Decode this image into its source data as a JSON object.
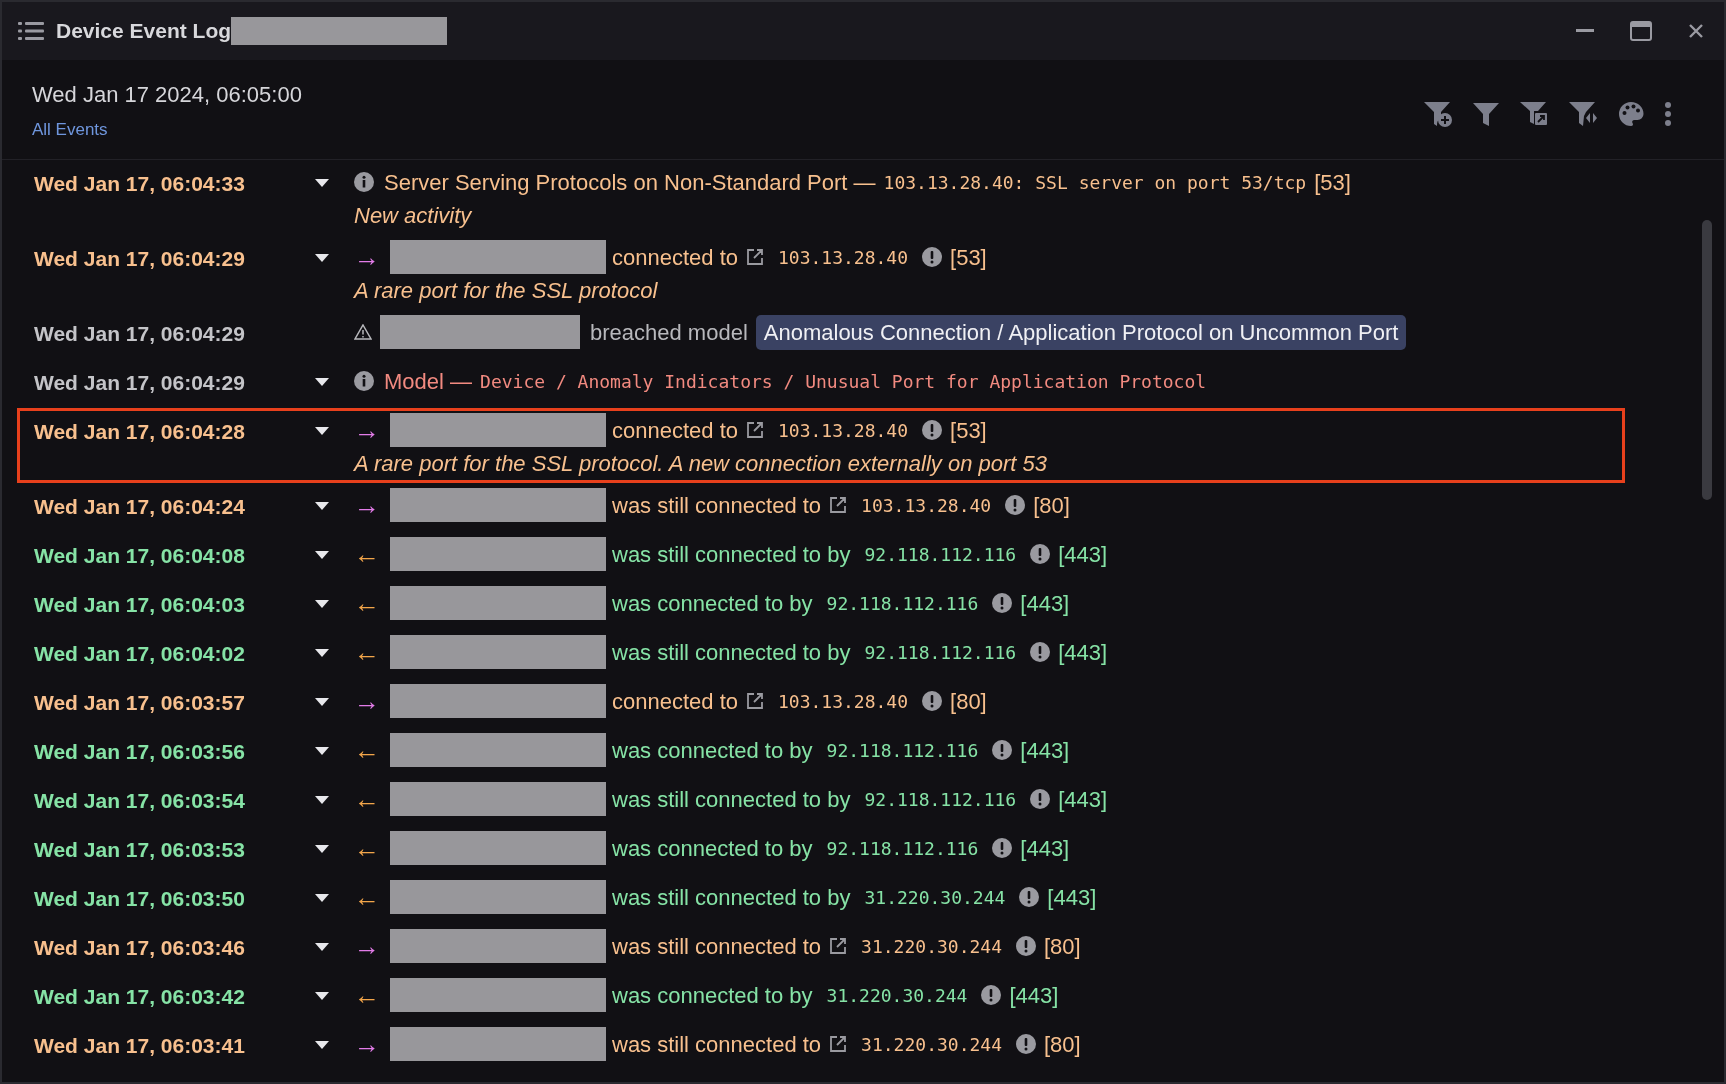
{
  "window": {
    "title": "Device Event Log"
  },
  "header": {
    "datetime": "Wed Jan 17 2024, 06:05:00",
    "filter_link": "All Events"
  },
  "events": [
    {
      "kind": "notice",
      "time": "Wed Jan 17, 06:04:33",
      "color": "#f8c08e",
      "expandable": true,
      "selected": false,
      "title": "Server Serving Protocols on Non-Standard Port —",
      "detail": "103.13.28.40: SSL server on port 53/tcp",
      "port": "[53]",
      "note": "New activity"
    },
    {
      "kind": "connection",
      "time": "Wed Jan 17, 06:04:29",
      "color": "#f8c08e",
      "expandable": true,
      "selected": false,
      "arrow": "→",
      "outgoing": true,
      "verb": "connected to",
      "external": true,
      "ip": "103.13.28.40",
      "port": "[53]",
      "note": "A rare port for the SSL protocol"
    },
    {
      "kind": "breach",
      "time": "Wed Jan 17, 06:04:29",
      "color": "#c4c4c8",
      "expandable": false,
      "selected": false,
      "verb": "breached model",
      "tag": "Anomalous Connection / Application Protocol on Uncommon Port"
    },
    {
      "kind": "model",
      "time": "Wed Jan 17, 06:04:29",
      "color": "#c4c4c8",
      "expandable": true,
      "selected": false,
      "label": "Model —",
      "path": "Device / Anomaly Indicators / Unusual Port for Application Protocol"
    },
    {
      "kind": "connection",
      "time": "Wed Jan 17, 06:04:28",
      "color": "#f8c08e",
      "expandable": true,
      "selected": true,
      "arrow": "→",
      "outgoing": true,
      "verb": "connected to",
      "external": true,
      "ip": "103.13.28.40",
      "port": "[53]",
      "note": "A rare port for the SSL protocol. A new connection externally on port 53"
    },
    {
      "kind": "connection",
      "time": "Wed Jan 17, 06:04:24",
      "color": "#f8c08e",
      "expandable": true,
      "selected": false,
      "arrow": "→",
      "outgoing": true,
      "verb": "was still connected to",
      "external": true,
      "ip": "103.13.28.40",
      "port": "[80]"
    },
    {
      "kind": "connection",
      "time": "Wed Jan 17, 06:04:08",
      "color": "#86e3a6",
      "expandable": true,
      "selected": false,
      "arrow": "←",
      "outgoing": false,
      "verb": "was still connected to by",
      "external": false,
      "ip": "92.118.112.116",
      "port": "[443]"
    },
    {
      "kind": "connection",
      "time": "Wed Jan 17, 06:04:03",
      "color": "#86e3a6",
      "expandable": true,
      "selected": false,
      "arrow": "←",
      "outgoing": false,
      "verb": "was connected to by",
      "external": false,
      "ip": "92.118.112.116",
      "port": "[443]"
    },
    {
      "kind": "connection",
      "time": "Wed Jan 17, 06:04:02",
      "color": "#86e3a6",
      "expandable": true,
      "selected": false,
      "arrow": "←",
      "outgoing": false,
      "verb": "was still connected to by",
      "external": false,
      "ip": "92.118.112.116",
      "port": "[443]"
    },
    {
      "kind": "connection",
      "time": "Wed Jan 17, 06:03:57",
      "color": "#f8c08e",
      "expandable": true,
      "selected": false,
      "arrow": "→",
      "outgoing": true,
      "verb": "connected to",
      "external": true,
      "ip": "103.13.28.40",
      "port": "[80]"
    },
    {
      "kind": "connection",
      "time": "Wed Jan 17, 06:03:56",
      "color": "#86e3a6",
      "expandable": true,
      "selected": false,
      "arrow": "←",
      "outgoing": false,
      "verb": "was connected to by",
      "external": false,
      "ip": "92.118.112.116",
      "port": "[443]"
    },
    {
      "kind": "connection",
      "time": "Wed Jan 17, 06:03:54",
      "color": "#86e3a6",
      "expandable": true,
      "selected": false,
      "arrow": "←",
      "outgoing": false,
      "verb": "was still connected to by",
      "external": false,
      "ip": "92.118.112.116",
      "port": "[443]"
    },
    {
      "kind": "connection",
      "time": "Wed Jan 17, 06:03:53",
      "color": "#86e3a6",
      "expandable": true,
      "selected": false,
      "arrow": "←",
      "outgoing": false,
      "verb": "was connected to by",
      "external": false,
      "ip": "92.118.112.116",
      "port": "[443]"
    },
    {
      "kind": "connection",
      "time": "Wed Jan 17, 06:03:50",
      "color": "#86e3a6",
      "expandable": true,
      "selected": false,
      "arrow": "←",
      "outgoing": false,
      "verb": "was still connected to by",
      "external": false,
      "ip": "31.220.30.244",
      "port": "[443]"
    },
    {
      "kind": "connection",
      "time": "Wed Jan 17, 06:03:46",
      "color": "#f8c08e",
      "expandable": true,
      "selected": false,
      "arrow": "→",
      "outgoing": true,
      "verb": "was still connected to",
      "external": true,
      "ip": "31.220.30.244",
      "port": "[80]"
    },
    {
      "kind": "connection",
      "time": "Wed Jan 17, 06:03:42",
      "color": "#86e3a6",
      "expandable": true,
      "selected": false,
      "arrow": "←",
      "outgoing": false,
      "verb": "was connected to by",
      "external": false,
      "ip": "31.220.30.244",
      "port": "[443]"
    },
    {
      "kind": "connection",
      "time": "Wed Jan 17, 06:03:41",
      "color": "#f8c08e",
      "expandable": true,
      "selected": false,
      "arrow": "→",
      "outgoing": true,
      "verb": "was still connected to",
      "external": true,
      "ip": "31.220.30.244",
      "port": "[80]"
    }
  ]
}
